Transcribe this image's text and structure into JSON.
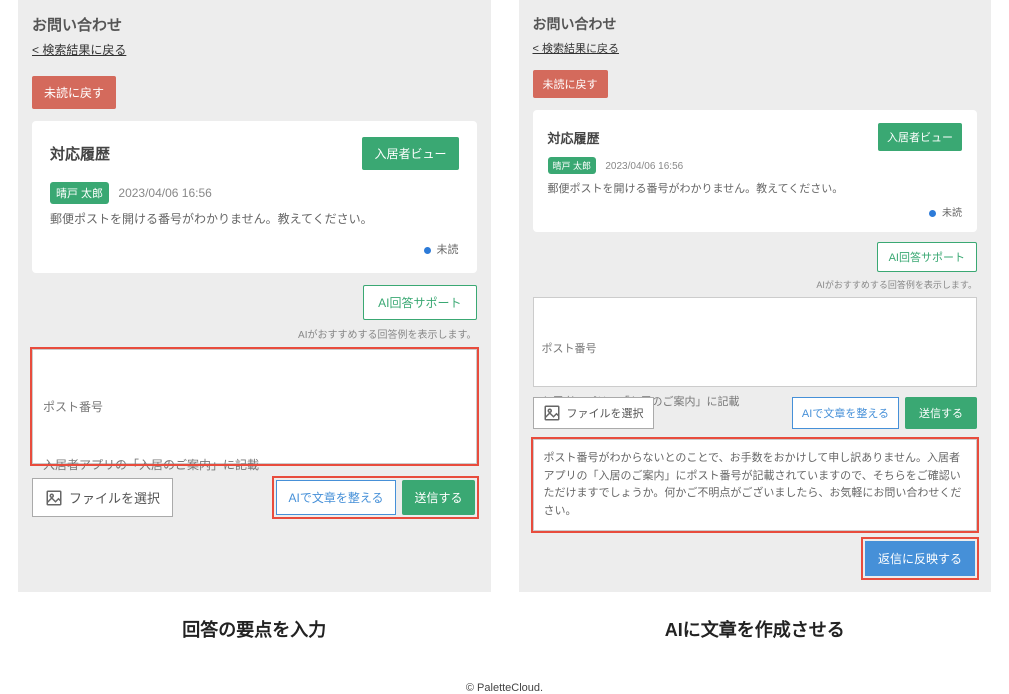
{
  "left": {
    "title": "お問い合わせ",
    "back": "< 検索結果に戻る",
    "mark_unread": "未読に戻す",
    "history_title": "対応履歴",
    "resident_view": "入居者ビュー",
    "name_badge": "晴戸 太郎",
    "timestamp": "2023/04/06 16:56",
    "message": "郵便ポストを開ける番号がわかりません。教えてください。",
    "status": "未読",
    "ai_support": "AI回答サポート",
    "hint": "AIがおすすめする回答例を表示します。",
    "textarea_l1": "ポスト番号",
    "textarea_l2": "入居者アプリの「入居のご案内」に記載",
    "file_select": "ファイルを選択",
    "ai_arrange": "AIで文章を整える",
    "send": "送信する"
  },
  "right": {
    "title": "お問い合わせ",
    "back": "< 検索結果に戻る",
    "mark_unread": "未読に戻す",
    "history_title": "対応履歴",
    "resident_view": "入居者ビュー",
    "name_badge": "晴戸 太郎",
    "timestamp": "2023/04/06 16:56",
    "message": "郵便ポストを開ける番号がわかりません。教えてください。",
    "status": "未読",
    "ai_support": "AI回答サポート",
    "hint": "AIがおすすめする回答例を表示します。",
    "textarea_l1": "ポスト番号",
    "textarea_l2": "入居者アプリの「入居のご案内」に記載",
    "file_select": "ファイルを選択",
    "ai_arrange": "AIで文章を整える",
    "send": "送信する",
    "ai_output": "ポスト番号がわからないとのことで、お手数をおかけして申し訳ありません。入居者アプリの「入居のご案内」にポスト番号が記載されていますので、そちらをご確認いただけますでしょうか。何かご不明点がございましたら、お気軽にお問い合わせください。",
    "reflect": "返信に反映する"
  },
  "captions": {
    "left": "回答の要点を入力",
    "right": "AIに文章を作成させる"
  },
  "footer": "© PaletteCloud."
}
